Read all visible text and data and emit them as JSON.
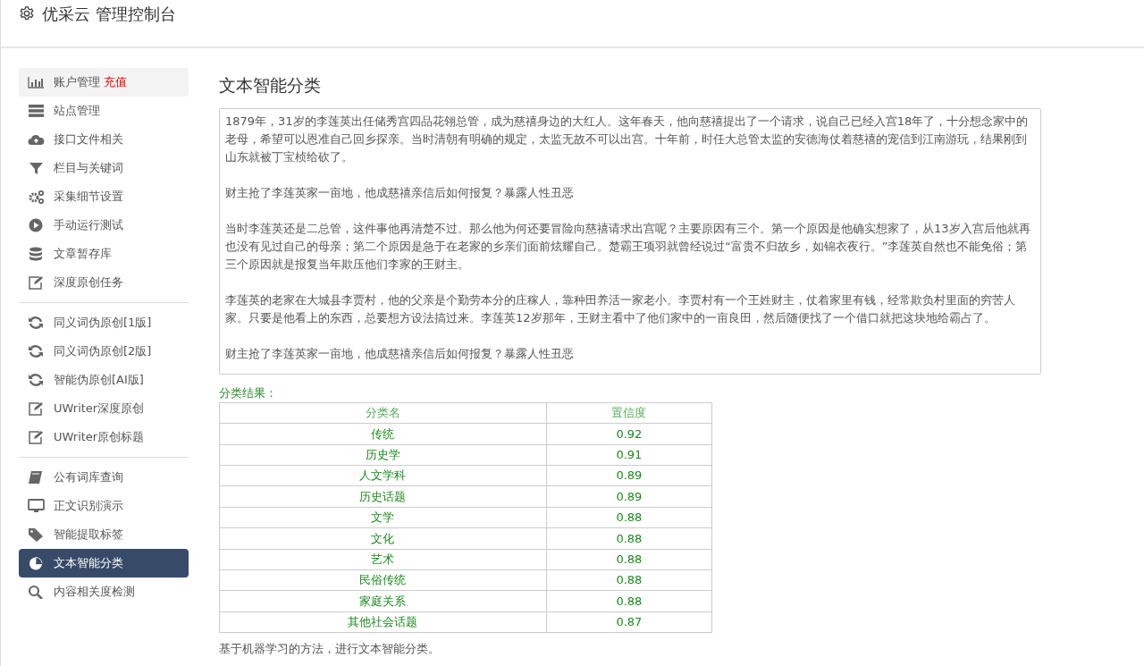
{
  "header": {
    "title": "优采云 管理控制台"
  },
  "sidebar": {
    "groups": [
      {
        "items": [
          {
            "label": "账户管理",
            "badge": "充值",
            "hovered": true,
            "selected": false
          },
          {
            "label": "站点管理",
            "hovered": false,
            "selected": false
          },
          {
            "label": "接口文件相关",
            "hovered": false,
            "selected": false
          },
          {
            "label": "栏目与关键词",
            "hovered": false,
            "selected": false
          },
          {
            "label": "采集细节设置",
            "hovered": false,
            "selected": false
          },
          {
            "label": "手动运行测试",
            "hovered": false,
            "selected": false
          },
          {
            "label": "文章暂存库",
            "hovered": false,
            "selected": false
          },
          {
            "label": "深度原创任务",
            "hovered": false,
            "selected": false
          }
        ]
      },
      {
        "items": [
          {
            "label": "同义词伪原创[1版]",
            "hovered": false,
            "selected": false
          },
          {
            "label": "同义词伪原创[2版]",
            "hovered": false,
            "selected": false
          },
          {
            "label": "智能伪原创[AI版]",
            "hovered": false,
            "selected": false
          },
          {
            "label": "UWriter深度原创",
            "hovered": false,
            "selected": false
          },
          {
            "label": "UWriter原创标题",
            "hovered": false,
            "selected": false
          }
        ]
      },
      {
        "items": [
          {
            "label": "公有词库查询",
            "hovered": false,
            "selected": false
          },
          {
            "label": "正文识别演示",
            "hovered": false,
            "selected": false
          },
          {
            "label": "智能提取标签",
            "hovered": false,
            "selected": false
          },
          {
            "label": "文本智能分类",
            "hovered": false,
            "selected": true
          },
          {
            "label": "内容相关度检测",
            "hovered": false,
            "selected": false
          }
        ]
      }
    ]
  },
  "main": {
    "title": "文本智能分类",
    "article": {
      "paragraphs": [
        "1879年，31岁的李莲英出任储秀宫四品花翎总管，成为慈禧身边的大红人。这年春天，他向慈禧提出了一个请求，说自己已经入宫18年了，十分想念家中的老母，希望可以恩准自己回乡探亲。当时清朝有明确的规定，太监无故不可以出宫。十年前，时任大总管太监的安德海仗着慈禧的宠信到江南游玩，结果刚到山东就被丁宝桢给砍了。",
        "财主抢了李莲英家一亩地，他成慈禧亲信后如何报复？暴露人性丑恶",
        "当时李莲英还是二总管，这件事他再清楚不过。那么他为何还要冒险向慈禧请求出宫呢？主要原因有三个。第一个原因是他确实想家了，从13岁入宫后他就再也没有见过自己的母亲；第二个原因是急于在老家的乡亲们面前炫耀自己。楚霸王项羽就曾经说过“富贵不归故乡，如锦衣夜行。”李莲英自然也不能免俗；第三个原因就是报复当年欺压他们李家的王财主。",
        "李莲英的老家在大城县李贾村，他的父亲是个勤劳本分的庄稼人，靠种田养活一家老小。李贾村有一个王姓财主，仗着家里有钱，经常欺负村里面的穷苦人家。只要是他看上的东西，总要想方设法搞过来。李莲英12岁那年，王财主看中了他们家中的一亩良田，然后随便找了一个借口就把这块地给霸占了。",
        "财主抢了李莲英家一亩地，他成慈禧亲信后如何报复？暴露人性丑恶"
      ]
    },
    "result_label": "分类结果：",
    "table": {
      "columns": [
        "分类名",
        "置信度"
      ],
      "rows": [
        [
          "传统",
          "0.92"
        ],
        [
          "历史学",
          "0.91"
        ],
        [
          "人文学科",
          "0.89"
        ],
        [
          "历史话题",
          "0.89"
        ],
        [
          "文学",
          "0.88"
        ],
        [
          "文化",
          "0.88"
        ],
        [
          "艺术",
          "0.88"
        ],
        [
          "民俗传统",
          "0.88"
        ],
        [
          "家庭关系",
          "0.88"
        ],
        [
          "其他社会话题",
          "0.87"
        ]
      ]
    },
    "note": "基于机器学习的方法，进行文本智能分类。"
  }
}
